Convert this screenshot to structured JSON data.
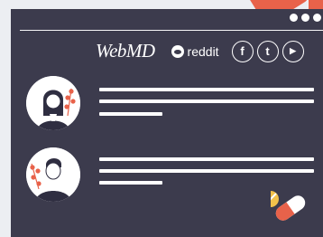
{
  "header": {
    "window_controls": [
      "dot",
      "dot",
      "dot"
    ],
    "brands": {
      "webmd": "WebMD",
      "reddit": "reddit"
    },
    "social_icons": [
      "facebook-icon",
      "twitter-icon",
      "youtube-icon"
    ],
    "social_glyphs": {
      "facebook": "f",
      "twitter": "t",
      "youtube": "▶"
    }
  },
  "posts": [
    {
      "avatar": "female-avatar"
    },
    {
      "avatar": "male-avatar"
    }
  ],
  "colors": {
    "panel": "#3c3b4d",
    "background": "#eceef2",
    "accent_coral": "#e8624a",
    "pill_yellow": "#f2c14b"
  },
  "decor": [
    "capsule-pill-icon",
    "round-pill-icon"
  ]
}
